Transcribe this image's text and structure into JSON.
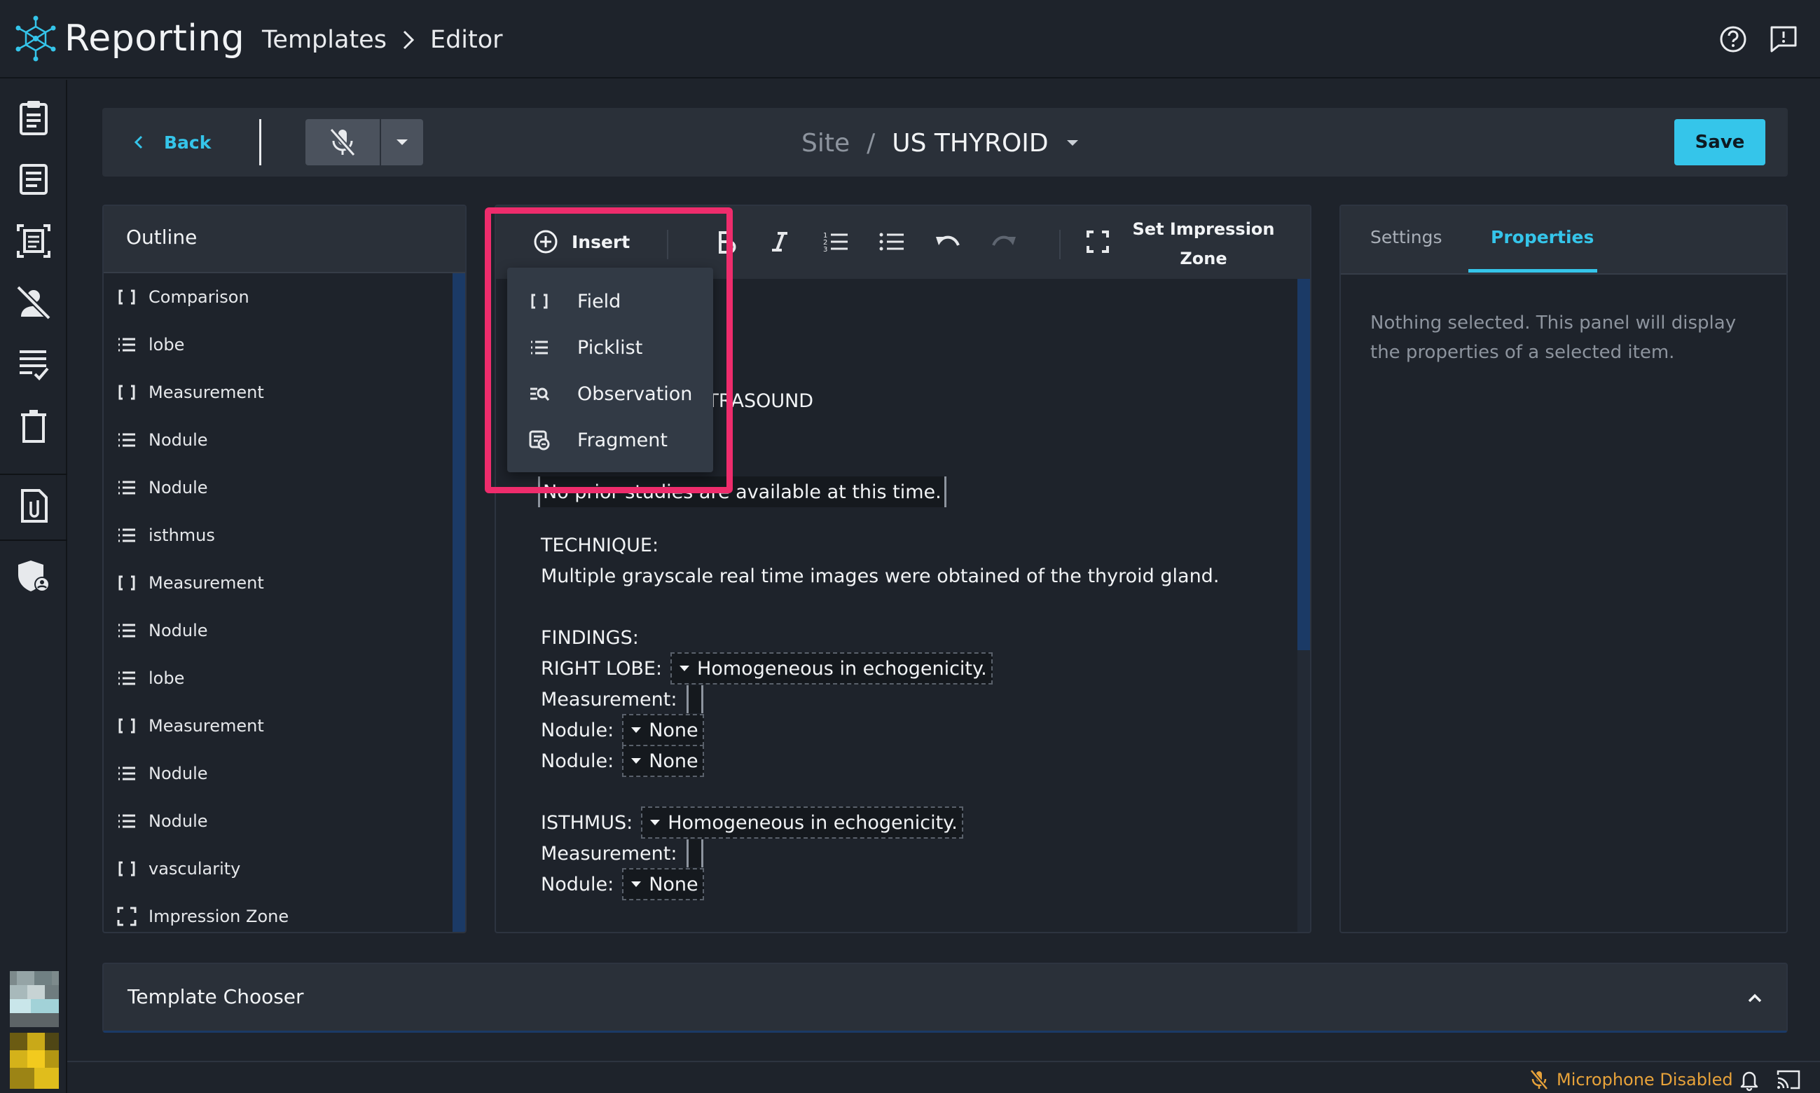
{
  "app": {
    "title": "Reporting"
  },
  "breadcrumb": {
    "first": "Templates",
    "second": "Editor"
  },
  "toolbar": {
    "back_label": "Back",
    "template_site": "Site",
    "template_separator": "/",
    "template_name": "US THYROID",
    "save_label": "Save"
  },
  "outline": {
    "title": "Outline",
    "items": [
      {
        "label": "Comparison",
        "icon": "field-bracket-icon"
      },
      {
        "label": "lobe",
        "icon": "picklist-icon"
      },
      {
        "label": "Measurement",
        "icon": "field-bracket-icon"
      },
      {
        "label": "Nodule",
        "icon": "picklist-icon"
      },
      {
        "label": "Nodule",
        "icon": "picklist-icon"
      },
      {
        "label": "isthmus",
        "icon": "picklist-icon"
      },
      {
        "label": "Measurement",
        "icon": "field-bracket-icon"
      },
      {
        "label": "Nodule",
        "icon": "picklist-icon"
      },
      {
        "label": "lobe",
        "icon": "picklist-icon"
      },
      {
        "label": "Measurement",
        "icon": "field-bracket-icon"
      },
      {
        "label": "Nodule",
        "icon": "picklist-icon"
      },
      {
        "label": "Nodule",
        "icon": "picklist-icon"
      },
      {
        "label": "vascularity",
        "icon": "field-bracket-icon"
      },
      {
        "label": "Impression Zone",
        "icon": "impression-zone-icon"
      }
    ]
  },
  "editor": {
    "insert_label": "Insert",
    "impression_label": "Set Impression Zone",
    "insert_menu": [
      {
        "label": "Field",
        "icon": "field-bracket-icon"
      },
      {
        "label": "Picklist",
        "icon": "picklist-icon"
      },
      {
        "label": "Observation",
        "icon": "observation-icon"
      },
      {
        "label": "Fragment",
        "icon": "fragment-icon"
      }
    ],
    "content": {
      "exam_fragment": "LTRASOUND",
      "comparison_text": "No prior studies are available at this time.",
      "technique_heading": "TECHNIQUE:",
      "technique_text": "Multiple grayscale real time images were obtained of the thyroid gland.",
      "findings_heading": "FINDINGS:",
      "right_lobe_label": "RIGHT LOBE:",
      "right_lobe_value": "Homogeneous in echogenicity.",
      "measurement_label": "Measurement:",
      "nodule_label": "Nodule:",
      "nodule_value": "None",
      "isthmus_label": "ISTHMUS:",
      "isthmus_value": "Homogeneous in echogenicity."
    }
  },
  "right_panel": {
    "tab_settings": "Settings",
    "tab_properties": "Properties",
    "empty_message": "Nothing selected. This panel will display the properties of a selected item."
  },
  "template_chooser": {
    "label": "Template Chooser"
  },
  "status": {
    "microphone": "Microphone Disabled"
  },
  "colors": {
    "accent": "#35c5ea",
    "highlight": "#ee2c6c",
    "warning": "#e7a23a",
    "background": "#1e232b",
    "panel": "#2a3039"
  }
}
